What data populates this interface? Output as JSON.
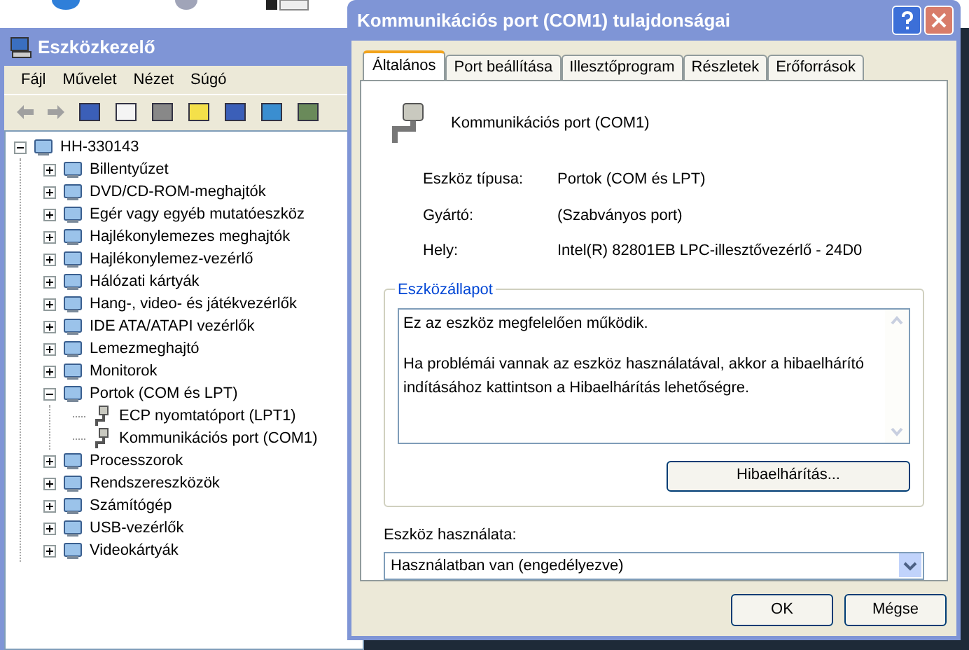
{
  "device_manager": {
    "title": "Eszközkezelő",
    "menu": [
      "Fájl",
      "Művelet",
      "Nézet",
      "Súgó"
    ],
    "tree": [
      {
        "label": "HH-330143",
        "expanded": true,
        "children": [
          {
            "label": "Billentyűzet",
            "expanded": false
          },
          {
            "label": "DVD/CD-ROM-meghajtók",
            "expanded": false
          },
          {
            "label": "Egér vagy egyéb mutatóeszköz",
            "expanded": false
          },
          {
            "label": "Hajlékonylemezes meghajtók",
            "expanded": false
          },
          {
            "label": "Hajlékonylemez-vezérlő",
            "expanded": false
          },
          {
            "label": "Hálózati kártyák",
            "expanded": false
          },
          {
            "label": "Hang-, video- és játékvezérlők",
            "expanded": false
          },
          {
            "label": "IDE ATA/ATAPI vezérlők",
            "expanded": false
          },
          {
            "label": "Lemezmeghajtó",
            "expanded": false
          },
          {
            "label": "Monitorok",
            "expanded": false
          },
          {
            "label": "Portok (COM és LPT)",
            "expanded": true,
            "children": [
              {
                "label": "ECP nyomtatóport (LPT1)"
              },
              {
                "label": "Kommunikációs port (COM1)"
              }
            ]
          },
          {
            "label": "Processzorok",
            "expanded": false
          },
          {
            "label": "Rendszereszközök",
            "expanded": false
          },
          {
            "label": "Számítógép",
            "expanded": false
          },
          {
            "label": "USB-vezérlők",
            "expanded": false
          },
          {
            "label": "Videokártyák",
            "expanded": false
          }
        ]
      }
    ]
  },
  "dialog": {
    "title": "Kommunikációs port (COM1) tulajdonságai",
    "tabs": [
      {
        "label": "Általános",
        "selected": true
      },
      {
        "label": "Port beállítása",
        "selected": false
      },
      {
        "label": "Illesztőprogram",
        "selected": false
      },
      {
        "label": "Részletek",
        "selected": false
      },
      {
        "label": "Erőforrások",
        "selected": false
      }
    ],
    "device_name": "Kommunikációs port (COM1)",
    "properties": [
      {
        "label": "Eszköz típusa:",
        "value": "Portok (COM és LPT)"
      },
      {
        "label": "Gyártó:",
        "value": "(Szabványos port)"
      },
      {
        "label": "Hely:",
        "value": "Intel(R) 82801EB LPC-illesztővezérlő - 24D0"
      }
    ],
    "status_group": {
      "title": "Eszközállapot",
      "paragraphs": [
        "Ez az eszköz megfelelően működik.",
        "Ha problémái vannak az eszköz használatával, akkor a hibaelhárító indításához kattintson a Hibaelhárítás lehetőségre."
      ],
      "button": "Hibaelhárítás..."
    },
    "usage": {
      "label": "Eszköz használata:",
      "value": "Használatban van (engedélyezve)"
    },
    "buttons": [
      "OK",
      "Mégse"
    ]
  }
}
